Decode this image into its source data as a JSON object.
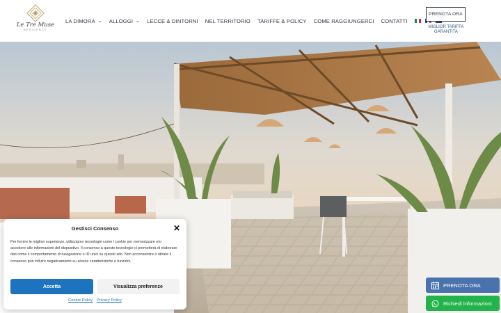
{
  "brand": {
    "name": "Le Tre Muse",
    "tagline": "RESIDENCE"
  },
  "nav": {
    "items": [
      {
        "label": "LA DIMORA",
        "dropdown": true
      },
      {
        "label": "ALLOGGI",
        "dropdown": true
      },
      {
        "label": "LECCE & DINTORNI",
        "dropdown": false
      },
      {
        "label": "NEL TERRITORIO",
        "dropdown": false
      },
      {
        "label": "TARIFFE & POLICY",
        "dropdown": false
      },
      {
        "label": "COME RAGGIUNGERCI",
        "dropdown": false
      },
      {
        "label": "CONTATTI",
        "dropdown": false
      }
    ],
    "languages": [
      "it-flag-icon",
      "fr-flag-icon",
      "en-flag-icon"
    ]
  },
  "header": {
    "book_label": "PRENOTA ORA",
    "best_rate_line1": "MIGLIOR TARIFFA",
    "best_rate_line2": "GARANTITA"
  },
  "consent": {
    "title": "Gestisci Consenso",
    "body": "Per fornire le migliori esperienze, utilizziamo tecnologie come i cookie per memorizzare e/o accedere alle informazioni del dispositivo. Il consenso a queste tecnologie ci permetterà di elaborare dati come il comportamento di navigazione o ID unici su questo sito. Non acconsentire o ritirare il consenso può influire negativamente su alcune caratteristiche e funzioni.",
    "accept_label": "Accetta",
    "prefs_label": "Visualizza preferenze",
    "cookie_policy_label": "Cookie Policy",
    "privacy_policy_label": "Privacy Policy"
  },
  "widgets": {
    "book_label": "PRENOTA ORA",
    "info_label": "Richiedi Informazioni"
  },
  "colors": {
    "nav_text": "#2d3440",
    "accept_blue": "#1e73be",
    "book_widget": "#4a73ae",
    "whatsapp_green": "#22b34a"
  }
}
